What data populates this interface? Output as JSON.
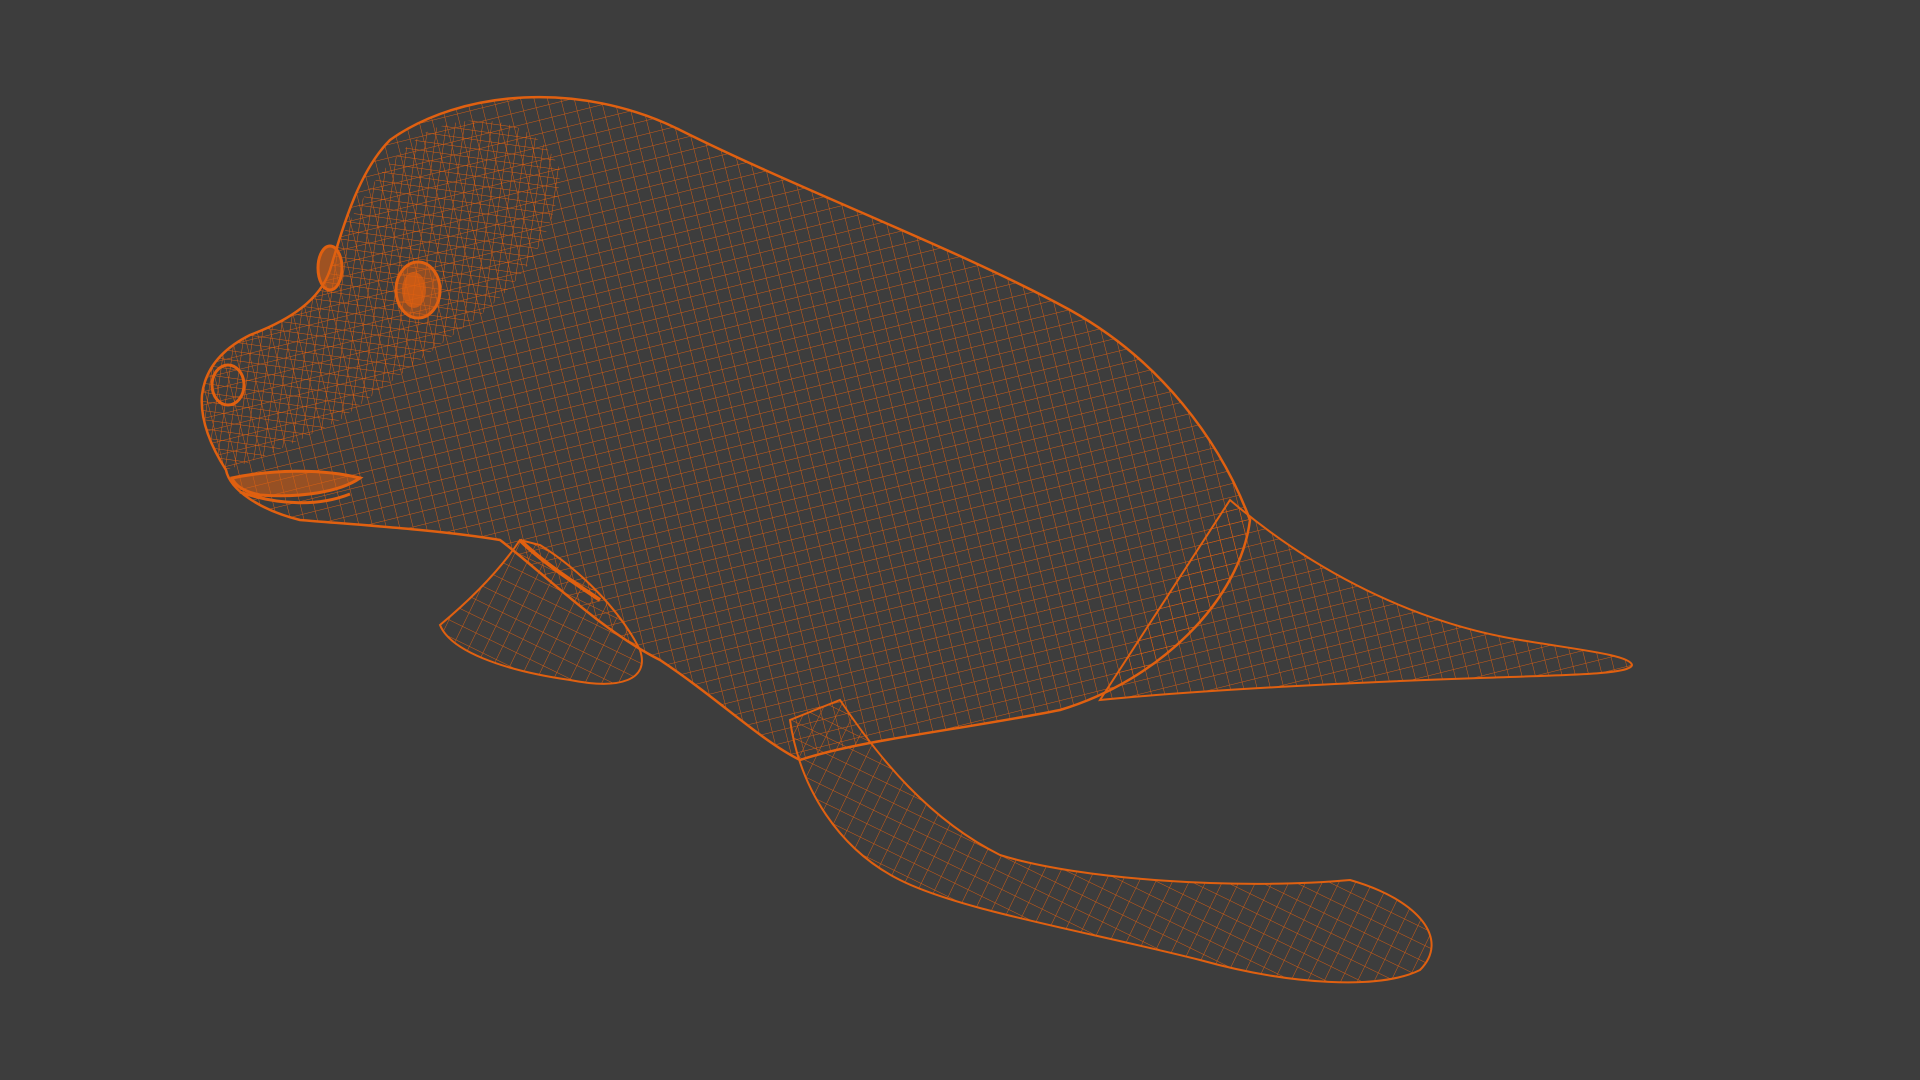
{
  "viewport": {
    "background_color": "#3d3d3d",
    "view_mode": "wireframe"
  },
  "model": {
    "subject": "seal",
    "wire_color": "#e06010",
    "parts": [
      "body",
      "head",
      "eye-left",
      "eye-right",
      "mouth",
      "front-flipper",
      "hind-flipper",
      "tail-fin"
    ]
  }
}
